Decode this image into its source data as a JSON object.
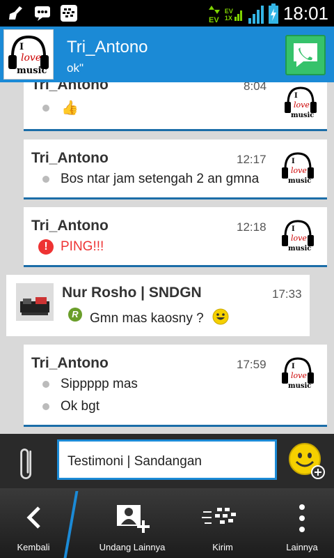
{
  "status_bar": {
    "time": "18:01",
    "network_labels": [
      "EV",
      "EV",
      "1X"
    ]
  },
  "header": {
    "contact_name": "Tri_Antono",
    "contact_status": "ok\""
  },
  "messages": [
    {
      "sender": "Tri_Antono",
      "time": "8:04",
      "lines": [
        "👍"
      ]
    },
    {
      "sender": "Tri_Antono",
      "time": "12:17",
      "lines": [
        "Bos ntar jam setengah 2 an gmna"
      ]
    },
    {
      "sender": "Tri_Antono",
      "time": "12:18",
      "ping": "PING!!!"
    },
    {
      "sender": "Nur Rosho  | SNDGN",
      "time": "17:33",
      "lines": [
        "Gmn mas kaosny ?"
      ],
      "read_marker": "R"
    },
    {
      "sender": "Tri_Antono",
      "time": "17:59",
      "lines": [
        "Sippppp mas",
        "Ok bgt"
      ]
    }
  ],
  "composer": {
    "input_value": "Testimoni | Sandangan"
  },
  "bottom_nav": {
    "back": "Kembali",
    "invite": "Undang Lainnya",
    "send": "Kirim",
    "more": "Lainnya"
  },
  "colors": {
    "accent": "#1b8ad6",
    "call": "#36c26b",
    "ping": "#e33333"
  }
}
